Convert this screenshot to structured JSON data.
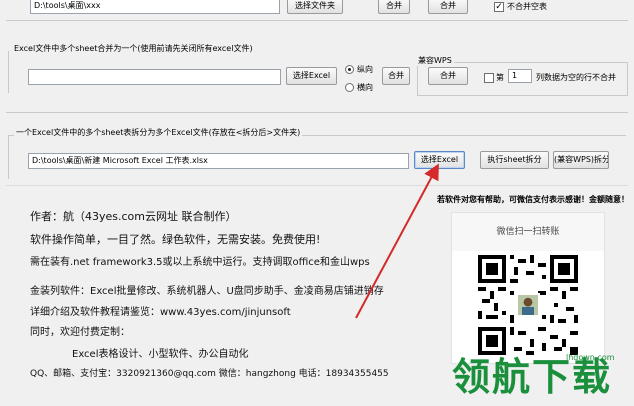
{
  "top": {
    "path_value": "D:\\tools\\桌面\\xxx",
    "select_folder_btn": "选择文件夹",
    "merge_btn_1": "合并",
    "merge_btn_2": "合并",
    "no_merge_blank_label": "不合并空表",
    "no_merge_blank_checked": true
  },
  "merge_sheets": {
    "title": "Excel文件中多个sheet合并为一个(使用前请先关闭所有excel文件)",
    "input_value": "",
    "select_excel_btn": "选择Excel",
    "radio_vertical": "纵向",
    "radio_horizontal": "横向",
    "vertical_selected": true,
    "merge_btn": "合并",
    "wps_group_title": "兼容WPS",
    "wps_merge_btn": "合并",
    "row_prefix": "第",
    "row_value": "1",
    "row_suffix": "列数据为空的行不合并",
    "row_checked": false
  },
  "split": {
    "title": "一个Excel文件中的多个sheet表拆分为多个Excel文件(存放在<拆分后>文件夹)",
    "path_value": "D:\\tools\\桌面\\新建 Microsoft Excel 工作表.xlsx",
    "select_excel_btn": "选择Excel",
    "split_btn": "执行sheet拆分",
    "wps_split_btn": "(兼容WPS)拆分"
  },
  "info": {
    "author": "作者：航（43yes.com云网址 联合制作）",
    "line1": "软件操作简单，一目了然。绿色软件，无需安装。免费使用!",
    "line2": "需在装有.net framework3.5或以上系统中运行。支持调取office和金山wps",
    "line3": "金装列软件：Excel批量修改、系统机器人、U盘同步助手、金凌商易店铺进销存",
    "line4": "详细介绍及软件教程请鉴览：www.43yes.com/jinjunsoft",
    "line5": "同时，欢迎付费定制：",
    "line6": "Excel表格设计、小型软件、办公自动化",
    "contact": "QQ、邮箱、支付宝：3320921360@qq.com     微信：hangzhong   电话：18934355455"
  },
  "donate": {
    "caption": "若软件对您有帮助，可微信支付表示感谢！金额随意！",
    "qr_title": "微信扫一扫转账"
  },
  "watermark": {
    "site": "lhdown.com",
    "brand": "领航下载"
  },
  "colors": {
    "arrow": "#d42a2a",
    "qr_title_bg": "#f7f7f7",
    "watermark_green": "#1a8f3c"
  }
}
